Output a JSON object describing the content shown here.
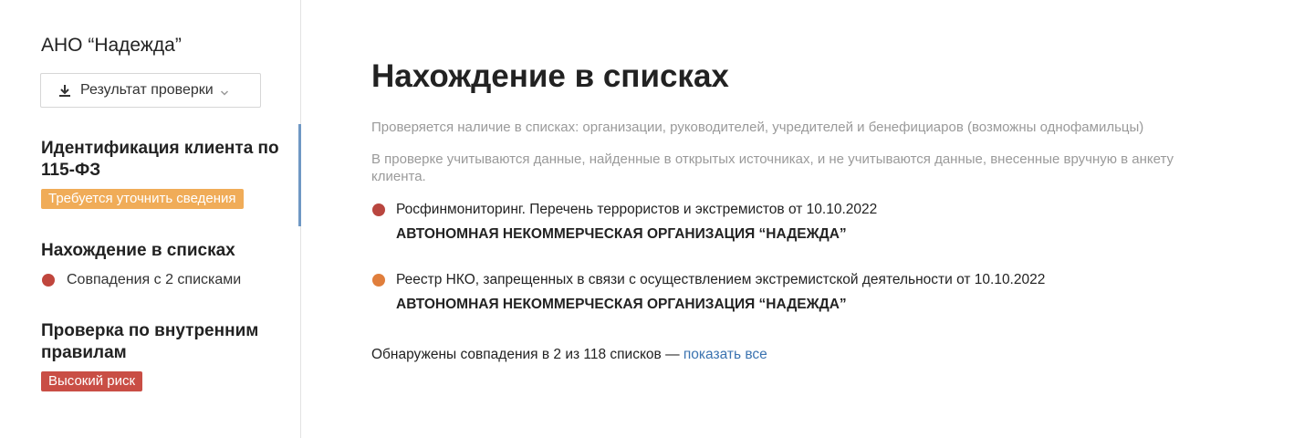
{
  "sidebar": {
    "org_name": "АНО “Надежда”",
    "result_button": {
      "label": "Результат проверки",
      "icon": "download-icon",
      "chevron": "chevron-down-icon"
    },
    "sections": [
      {
        "title": "Идентификация клиента по 115-ФЗ",
        "badge": "Требуется уточнить сведения",
        "badge_color": "#f0ac58",
        "active": true
      },
      {
        "title": "Нахождение в списках",
        "status_text": "Совпадения с 2 списками",
        "status_dot_color": "#c0463d"
      },
      {
        "title": "Проверка по внутренним правилам",
        "badge": "Высокий риск",
        "badge_color": "#c94e45"
      }
    ]
  },
  "main": {
    "title": "Нахождение в списках",
    "note1": "Проверяется наличие в списках: организации, руководителей, учредителей и бенефициаров (возможны однофамильцы)",
    "note2": "В проверке учитываются данные, найденные в открытых источниках, и не учитываются данные, внесенные вручную в анкету клиента.",
    "matches": [
      {
        "list": "Росфинмониторинг. Перечень террористов и экстремистов от 10.10.2022",
        "entity": "АВТОНОМНАЯ НЕКОММЕРЧЕСКАЯ ОРГАНИЗАЦИЯ “НАДЕЖДА”",
        "dot_color": "#b9463f"
      },
      {
        "list": "Реестр НКО, запрещенных в связи с осуществлением экстремистской деятельности от 10.10.2022",
        "entity": "АВТОНОМНАЯ НЕКОММЕРЧЕСКАЯ ОРГАНИЗАЦИЯ “НАДЕЖДА”",
        "dot_color": "#e07e3c"
      }
    ],
    "summary_text": "Обнаружены совпадения в 2 из 118 списков —",
    "show_all_link": "показать все",
    "link_color": "#3b73b0"
  }
}
